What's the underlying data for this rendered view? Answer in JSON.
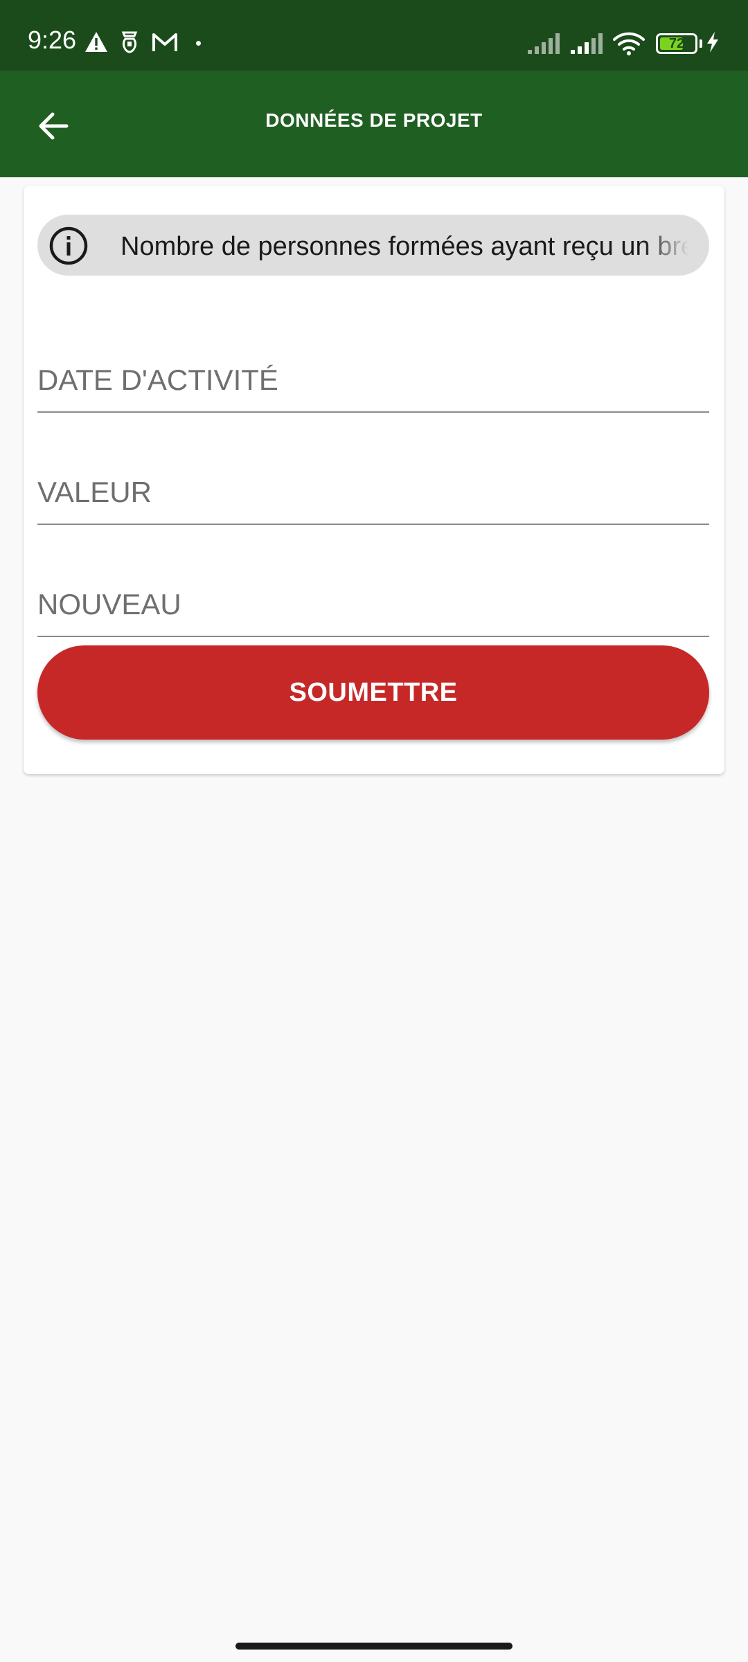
{
  "status_bar": {
    "time": "9:26",
    "battery_level": "72",
    "battery_percent": 72,
    "icons": [
      "alert-icon",
      "sim-icon",
      "gmail-icon",
      "notification-dot",
      "signal-icon",
      "signal-icon",
      "wifi-icon",
      "battery-icon",
      "charging-icon"
    ]
  },
  "app_bar": {
    "title": "DONNÉES DE PROJET",
    "back_icon": "arrow-left-icon"
  },
  "form": {
    "info_icon": "info-icon",
    "indicator_text": "Nombre de personnes formées ayant reçu un brevet",
    "fields": {
      "date_label": "DATE D'ACTIVITÉ",
      "value_label": "VALEUR",
      "new_label": "NOUVEAU"
    },
    "submit_label": "SOUMETTRE"
  },
  "colors": {
    "status_bar": "#1b4b1b",
    "app_bar": "#1f5f22",
    "submit": "#c62828",
    "background": "#f9f9f9"
  }
}
